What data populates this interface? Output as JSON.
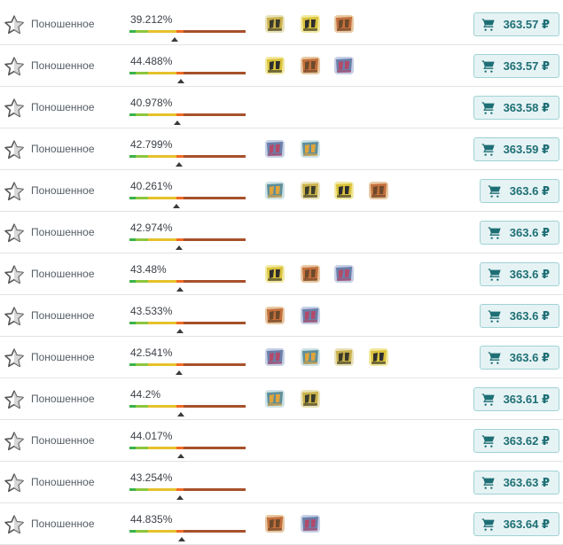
{
  "currency": "₽",
  "rows": [
    {
      "condition": "Поношенное",
      "float": "39.212%",
      "float_value": 0.39212,
      "stickers": [
        "sticker-2",
        "sticker-2",
        "sticker-2"
      ],
      "price": "363.57 ₽"
    },
    {
      "condition": "Поношенное",
      "float": "44.488%",
      "float_value": 0.44488,
      "stickers": [
        "sticker-2",
        "sticker-2",
        "sticker-2"
      ],
      "price": "363.57 ₽"
    },
    {
      "condition": "Поношенное",
      "float": "40.978%",
      "float_value": 0.40978,
      "stickers": [],
      "price": "363.58 ₽"
    },
    {
      "condition": "Поношенное",
      "float": "42.799%",
      "float_value": 0.42799,
      "stickers": [
        "sticker-2",
        "sticker-2"
      ],
      "price": "363.59 ₽"
    },
    {
      "condition": "Поношенное",
      "float": "40.261%",
      "float_value": 0.40261,
      "stickers": [
        "sticker-2",
        "sticker-2",
        "sticker-2",
        "sticker-2"
      ],
      "price": "363.6 ₽"
    },
    {
      "condition": "Поношенное",
      "float": "42.974%",
      "float_value": 0.42974,
      "stickers": [],
      "price": "363.6 ₽"
    },
    {
      "condition": "Поношенное",
      "float": "43.48%",
      "float_value": 0.4348,
      "stickers": [
        "sticker-2",
        "sticker-2",
        "sticker-2"
      ],
      "price": "363.6 ₽"
    },
    {
      "condition": "Поношенное",
      "float": "43.533%",
      "float_value": 0.43533,
      "stickers": [
        "sticker-2",
        "sticker-2"
      ],
      "price": "363.6 ₽"
    },
    {
      "condition": "Поношенное",
      "float": "42.541%",
      "float_value": 0.42541,
      "stickers": [
        "sticker-2",
        "sticker-2",
        "sticker-2",
        "sticker-2"
      ],
      "price": "363.6 ₽"
    },
    {
      "condition": "Поношенное",
      "float": "44.2%",
      "float_value": 0.442,
      "stickers": [
        "sticker-2",
        "sticker-2"
      ],
      "price": "363.61 ₽"
    },
    {
      "condition": "Поношенное",
      "float": "44.017%",
      "float_value": 0.44017,
      "stickers": [],
      "price": "363.62 ₽"
    },
    {
      "condition": "Поношенное",
      "float": "43.254%",
      "float_value": 0.43254,
      "stickers": [],
      "price": "363.63 ₽"
    },
    {
      "condition": "Поношенное",
      "float": "44.835%",
      "float_value": 0.44835,
      "stickers": [
        "sticker-2",
        "sticker-2"
      ],
      "price": "363.64 ₽"
    }
  ],
  "icons": {
    "favorite": "star-outline-icon",
    "cart": "cart-icon"
  },
  "colors": {
    "button_bg": "#e6f3f4",
    "button_border": "#9fd2d5",
    "button_text": "#1e6f75"
  }
}
